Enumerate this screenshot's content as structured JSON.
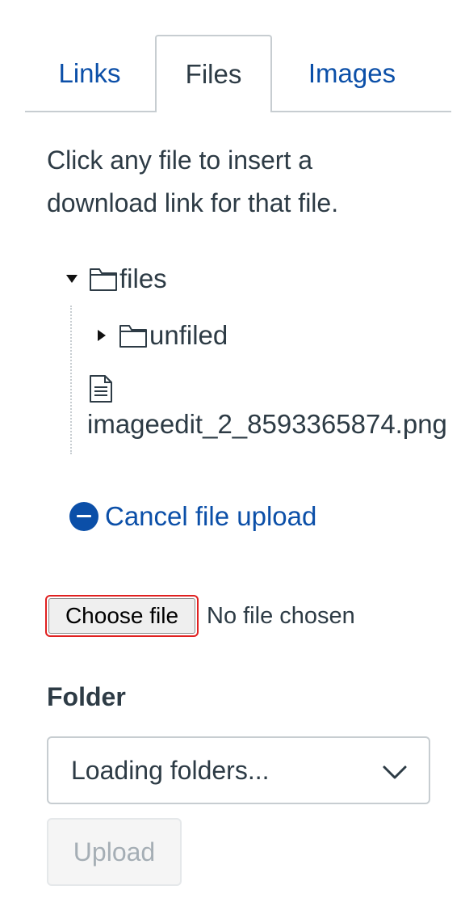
{
  "tabs": [
    {
      "label": "Links",
      "active": false
    },
    {
      "label": "Files",
      "active": true
    },
    {
      "label": "Images",
      "active": false
    }
  ],
  "instructions": "Click any file to insert a download link for that file.",
  "tree": {
    "root": {
      "label": "files",
      "expanded": true
    },
    "children": [
      {
        "label": "unfiled",
        "type": "folder",
        "expanded": false
      },
      {
        "label": "imageedit_2_8593365874.png",
        "type": "file"
      }
    ]
  },
  "upload": {
    "cancel_label": "Cancel file upload",
    "choose_file_label": "Choose file",
    "no_file_label": "No file chosen",
    "folder_label": "Folder",
    "folder_select_value": "Loading folders...",
    "upload_label": "Upload"
  },
  "colors": {
    "link": "#0b4fa8",
    "text": "#2d3b45",
    "border": "#c7cdd1",
    "focus_ring": "#e02020",
    "disabled_text": "#a5aeb5"
  },
  "icons": {
    "tree_root_toggle": "caret-down-icon",
    "tree_sub_toggle": "caret-right-icon",
    "folder": "folder-icon",
    "file": "document-icon",
    "cancel": "minus-circle-icon",
    "select": "chevron-down-icon"
  }
}
